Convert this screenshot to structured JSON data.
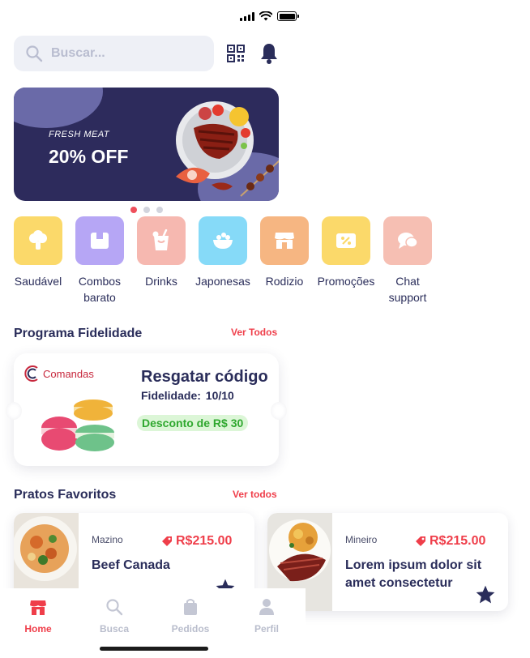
{
  "search": {
    "placeholder": "Buscar..."
  },
  "banner": {
    "tagline": "FRESH MEAT",
    "offer": "20% OFF",
    "active_dot": 0,
    "dot_count": 3
  },
  "categories": [
    {
      "label": "Saudável",
      "color": "#fbd96a",
      "icon": "broccoli-icon"
    },
    {
      "label": "Combos barato",
      "color": "#b6a6f5",
      "icon": "box-icon"
    },
    {
      "label": "Drinks",
      "color": "#f6b8b0",
      "icon": "drink-icon"
    },
    {
      "label": "Japonesas",
      "color": "#86daf8",
      "icon": "bowl-icon"
    },
    {
      "label": "Rodizio",
      "color": "#f6b682",
      "icon": "store-icon"
    },
    {
      "label": "Promoções",
      "color": "#fbd96a",
      "icon": "coupon-icon"
    },
    {
      "label": "Chat support",
      "color": "#f6bfb3",
      "icon": "chat-icon"
    }
  ],
  "loyalty": {
    "section_title": "Programa Fidelidade",
    "see_all": "Ver Todos",
    "brand": "Comandas",
    "title": "Resgatar código",
    "fidelity": "Fidelidade:  10/10",
    "discount": "Desconto de R$ 30"
  },
  "favorites": {
    "section_title": "Pratos Favoritos",
    "see_all": "Ver todos",
    "items": [
      {
        "restaurant": "Mazino",
        "price": "R$215.00",
        "name": "Beef Canada"
      },
      {
        "restaurant": "Mineiro",
        "price": "R$215.00",
        "name": "Lorem ipsum dolor sit amet consectetur"
      }
    ]
  },
  "nav": {
    "items": [
      {
        "label": "Home",
        "icon": "home-icon",
        "active": true
      },
      {
        "label": "Busca",
        "icon": "search-icon",
        "active": false
      },
      {
        "label": "Pedidos",
        "icon": "bag-icon",
        "active": false
      },
      {
        "label": "Perfil",
        "icon": "user-icon",
        "active": false
      }
    ]
  },
  "colors": {
    "primary": "#2a2d5a",
    "accent": "#ef3e4a",
    "banner": "#2d2b5c"
  }
}
